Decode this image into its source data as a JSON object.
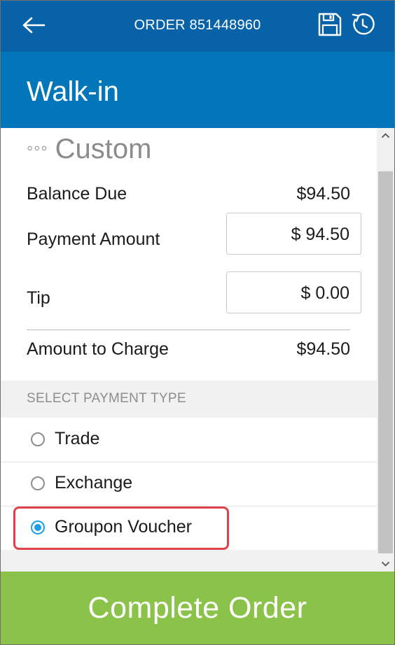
{
  "topbar": {
    "order_title": "ORDER 851448960",
    "back_icon": "arrow-left-icon",
    "save_icon": "floppy-disk-icon",
    "history_icon": "clock-icon"
  },
  "customer": {
    "name": "Walk-in"
  },
  "payment": {
    "method_name": "Custom",
    "method_icon": "ellipsis-icon",
    "balance_due_label": "Balance Due",
    "balance_due_value": "$94.50",
    "payment_amount_label": "Payment Amount",
    "payment_amount_value": "$ 94.50",
    "tip_label": "Tip",
    "tip_value": "$ 0.00",
    "amount_to_charge_label": "Amount to Charge",
    "amount_to_charge_value": "$94.50"
  },
  "payment_type": {
    "section_title": "SELECT PAYMENT TYPE",
    "options": [
      {
        "label": "Trade",
        "selected": false
      },
      {
        "label": "Exchange",
        "selected": false
      },
      {
        "label": "Groupon Voucher",
        "selected": true
      }
    ]
  },
  "footer": {
    "complete_label": "Complete Order"
  },
  "colors": {
    "topbar": "#0762a8",
    "header": "#0176b8",
    "accent_radio": "#1c9ee8",
    "highlight": "#e0424b",
    "complete_button": "#8bc34a"
  }
}
